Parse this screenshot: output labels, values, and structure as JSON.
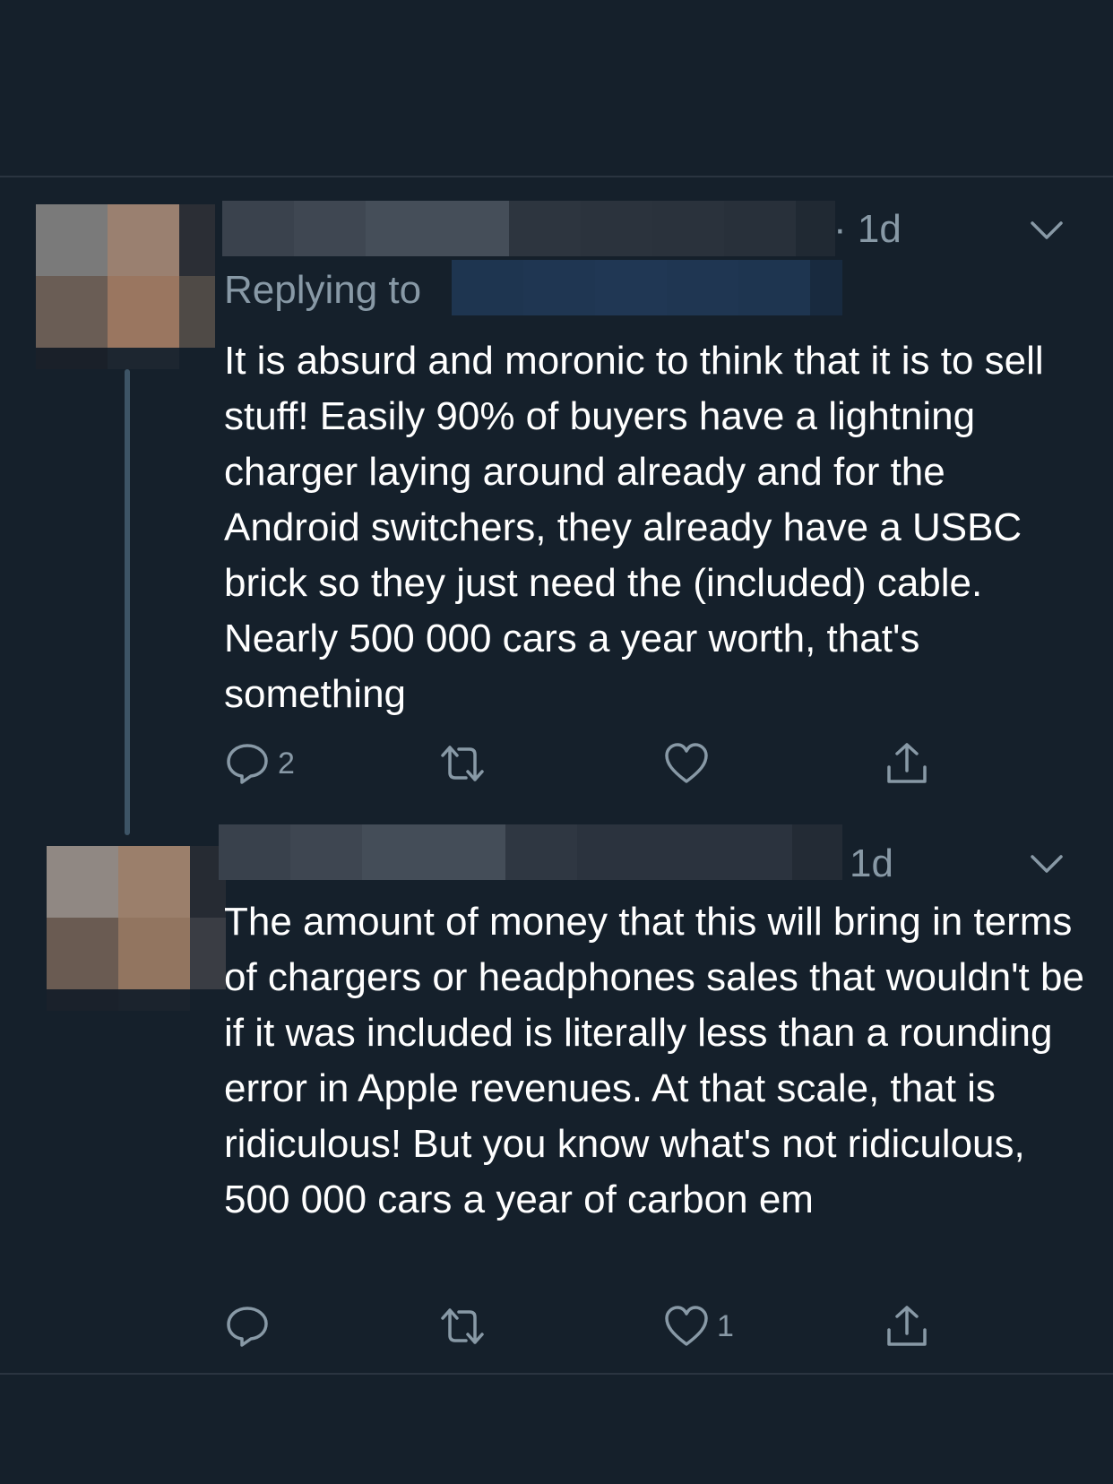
{
  "tweets": [
    {
      "timestamp": "· 1d",
      "replying_label": "Replying to",
      "body": "It is absurd and moronic to think that it is to sell stuff! Easily 90% of buyers have a lightning charger laying around already and for the Android switchers, they already have a USBC brick so they just need the (included) cable. Nearly 500 000 cars a year worth, that's something",
      "actions": {
        "reply_count": "2",
        "retweet_count": "",
        "like_count": ""
      }
    },
    {
      "timestamp": "1d",
      "body": "The amount of money that this will bring in terms of chargers or headphones sales that wouldn't be if it was included is literally less than a rounding error in Apple revenues. At that scale, that is ridiculous! But you know what's not ridiculous, 500 000 cars a year of carbon em",
      "actions": {
        "reply_count": "",
        "retweet_count": "",
        "like_count": "1"
      }
    }
  ],
  "colors": {
    "background": "#15202b",
    "secondary_text": "#8899a6",
    "primary_text": "#ffffff",
    "thread_line": "#3d5466"
  },
  "icons": [
    "reply-icon",
    "retweet-icon",
    "like-icon",
    "share-icon",
    "chevron-down-icon"
  ]
}
